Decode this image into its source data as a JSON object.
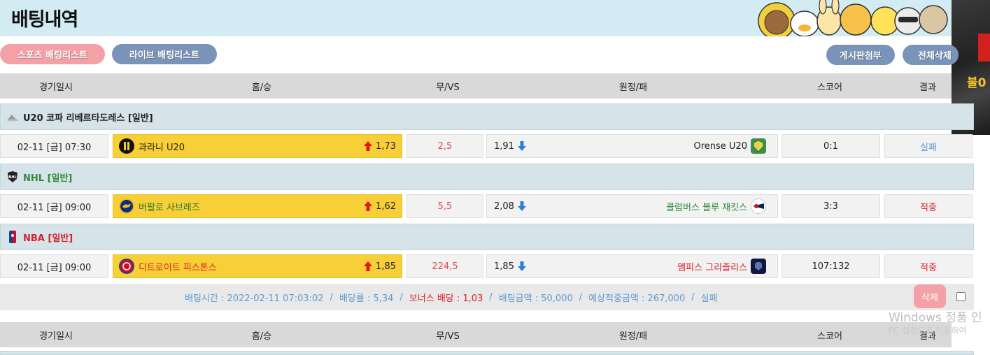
{
  "header": {
    "title": "배팅내역"
  },
  "right_banner": {
    "text": "불0"
  },
  "buttons": {
    "sports_list": "스포츠 배팅리스트",
    "live_list": "라이브 배팅리스트",
    "board_attach": "게시판첨부",
    "delete_all": "전체삭제"
  },
  "columns": {
    "date": "경기일시",
    "home": "홈/승",
    "draw": "무/VS",
    "away": "원정/패",
    "score": "스코어",
    "result": "결과"
  },
  "games": [
    {
      "league": "U20 코파 리베르타도레스 [일반]",
      "league_color": "#222222",
      "league_icon": "soccer-icon",
      "date": "02-11 [금] 07:30",
      "home": "과라니 U20",
      "home_color": "#222222",
      "home_odds": "1,73",
      "draw": "2,5",
      "away_odds": "1,91",
      "away": "Orense U20",
      "away_color": "#222222",
      "score": "0:1",
      "result": "실패",
      "result_color": "#5d9ad3"
    },
    {
      "league": "NHL [일반]",
      "league_color": "#2e8b3a",
      "league_icon": "nhl-icon",
      "date": "02-11 [금] 09:00",
      "home": "버팔로 사브레즈",
      "home_color": "#2e7d32",
      "home_odds": "1,62",
      "draw": "5,5",
      "away_odds": "2,08",
      "away": "콜럼버스 블루 재킷스",
      "away_color": "#2e8b3a",
      "score": "3:3",
      "result": "적중",
      "result_color": "#d9212b"
    },
    {
      "league": "NBA [일반]",
      "league_color": "#d9212b",
      "league_icon": "nba-icon",
      "date": "02-11 [금] 09:00",
      "home": "디트로이트 피스톤스",
      "home_color": "#d9212b",
      "home_odds": "1,85",
      "draw": "224,5",
      "away_odds": "1,85",
      "away": "멤피스 그리즐리스",
      "away_color": "#d9212b",
      "score": "107:132",
      "result": "적중",
      "result_color": "#d9212b"
    }
  ],
  "summary": {
    "bet_time": "배팅시간 : 2022-02-11 07:03:02",
    "odds": "배당률 : 5,34",
    "bonus": "보너스 배당 : 1,03",
    "amount": "배팅금액 : 50,000",
    "expected": "예상적중금액 : 267,000",
    "status": "실패",
    "delete_label": "삭제"
  },
  "watermark": {
    "line1": "Windows 정품 인",
    "line2": "PC 설정으로 이동하여"
  },
  "colors": {
    "header_bg": "#d3ecf3",
    "home_cell": "#f8cf36",
    "pink": "#f3a1a6",
    "slate": "#7a93b9",
    "up_arrow": "#e3141b",
    "down_arrow": "#2f7fe0"
  }
}
